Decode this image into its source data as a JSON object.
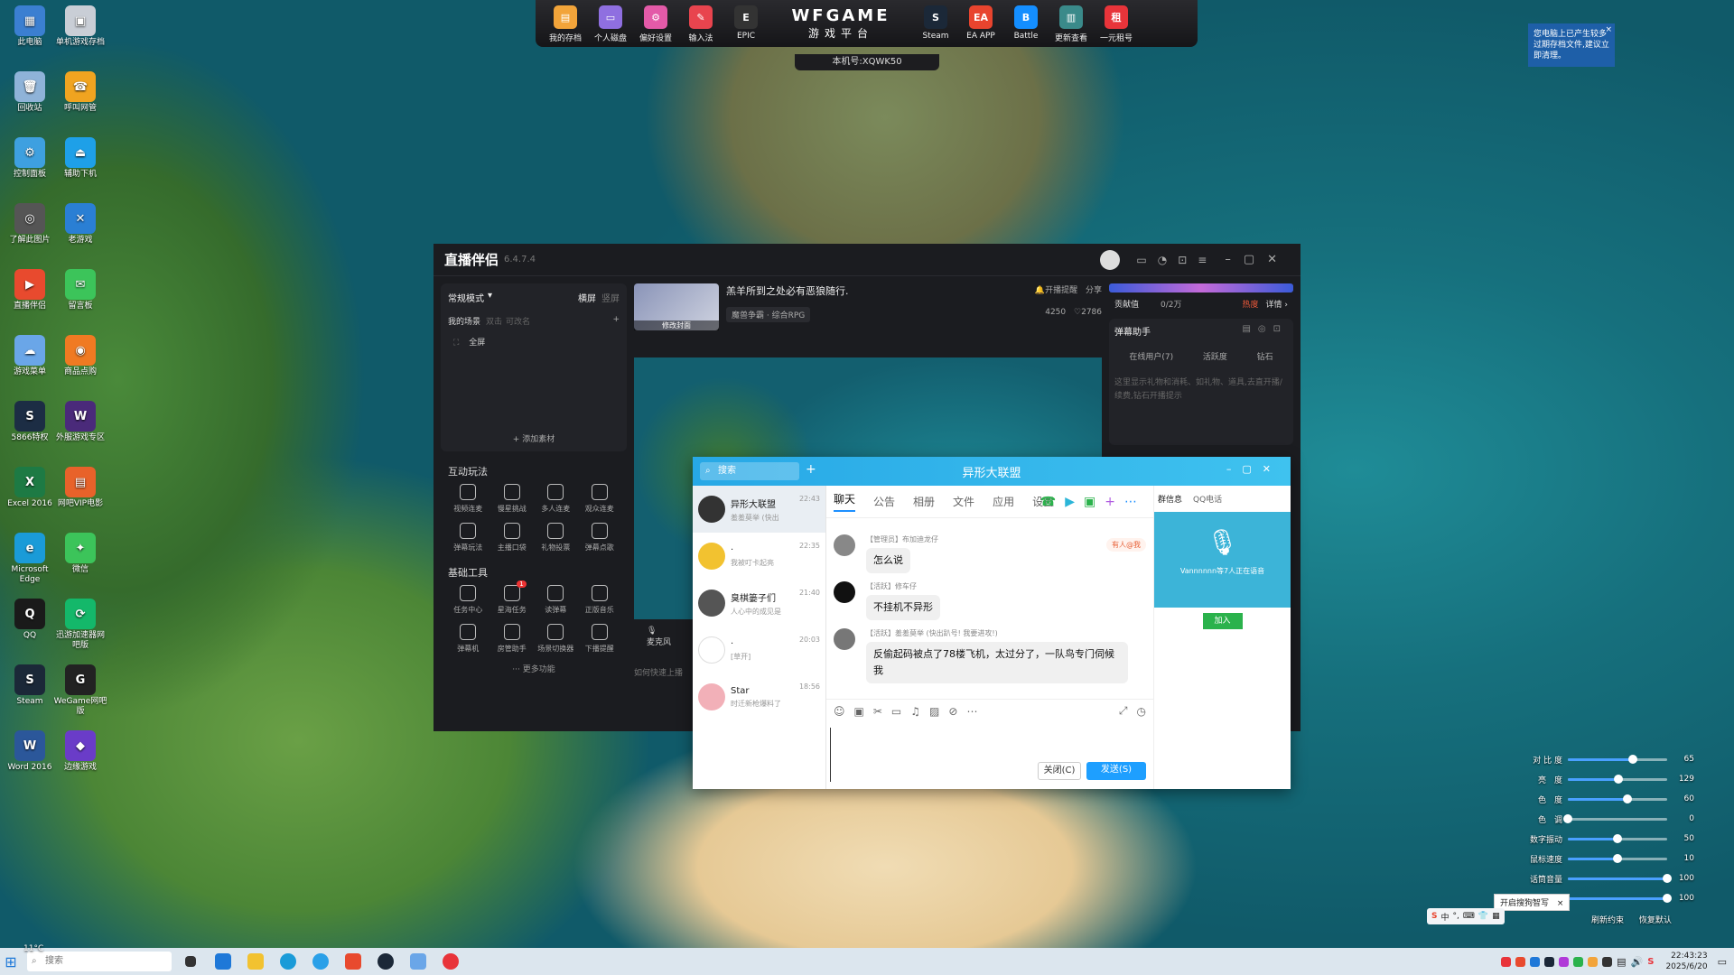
{
  "desktop": {
    "icons": [
      {
        "label": "此电脑",
        "color": "#3b7fd1",
        "glyph": "▦"
      },
      {
        "label": "单机游戏存档",
        "color": "#c9ced6",
        "glyph": "▣"
      },
      {
        "label": "回收站",
        "color": "#8fb3d8",
        "glyph": "🗑"
      },
      {
        "label": "呼叫网管",
        "color": "#f0a420",
        "glyph": "☎"
      },
      {
        "label": "控制面板",
        "color": "#3ea0e0",
        "glyph": "⚙"
      },
      {
        "label": "辅助下机",
        "color": "#1ea0e8",
        "glyph": "⏏"
      },
      {
        "label": "了解此图片",
        "color": "#555",
        "glyph": "◎"
      },
      {
        "label": "老游戏",
        "color": "#2a7fd4",
        "glyph": "✕"
      },
      {
        "label": "直播伴侣",
        "color": "#e84a2e",
        "glyph": "▶"
      },
      {
        "label": "留言板",
        "color": "#3cc45a",
        "glyph": "✉"
      },
      {
        "label": "游戏菜单",
        "color": "#6aa6e8",
        "glyph": "☁"
      },
      {
        "label": "商品点购",
        "color": "#f07a22",
        "glyph": "◉"
      },
      {
        "label": "5866特权",
        "color": "#1c2d44",
        "glyph": "S"
      },
      {
        "label": "外服游戏专区",
        "color": "#4a2a7a",
        "glyph": "W"
      },
      {
        "label": "Excel 2016",
        "color": "#1d7a44",
        "glyph": "X"
      },
      {
        "label": "网吧VIP电影",
        "color": "#e8622a",
        "glyph": "▤"
      },
      {
        "label": "Microsoft Edge",
        "color": "#1a9bd8",
        "glyph": "e"
      },
      {
        "label": "微信",
        "color": "#3cc45a",
        "glyph": "✦"
      },
      {
        "label": "QQ",
        "color": "#1a1a1a",
        "glyph": "Q"
      },
      {
        "label": "迅游加速器网吧版",
        "color": "#14b86a",
        "glyph": "⟳"
      },
      {
        "label": "Steam",
        "color": "#1b2838",
        "glyph": "S"
      },
      {
        "label": "WeGame网吧版",
        "color": "#222",
        "glyph": "G"
      },
      {
        "label": "Word 2016",
        "color": "#2b579a",
        "glyph": "W"
      },
      {
        "label": "边缘游戏",
        "color": "#6a3cc8",
        "glyph": "◆"
      }
    ]
  },
  "gamebar": {
    "left_items": [
      {
        "label": "我的存档",
        "color": "#f2a43a",
        "glyph": "▤"
      },
      {
        "label": "个人磁盘",
        "color": "#8f6fe0",
        "glyph": "▭"
      },
      {
        "label": "偏好设置",
        "color": "#e35aa8",
        "glyph": "⚙"
      },
      {
        "label": "输入法",
        "color": "#e8444e",
        "glyph": "✎"
      },
      {
        "label": "EPIC",
        "color": "#333",
        "glyph": "E"
      }
    ],
    "logo_title": "WFGAME",
    "logo_subtitle": "游戏平台",
    "right_items": [
      {
        "label": "Steam",
        "color": "#1b2838",
        "glyph": "S"
      },
      {
        "label": "EA APP",
        "color": "#e8442e",
        "glyph": "EA"
      },
      {
        "label": "Battle",
        "color": "#148eff",
        "glyph": "B"
      },
      {
        "label": "更新查看",
        "color": "#3a8a8a",
        "glyph": "▥"
      },
      {
        "label": "一元租号",
        "color": "#e8343a",
        "glyph": "租"
      }
    ],
    "machine_no": "本机号:XQWK50"
  },
  "notice": {
    "text": "您电脑上已产生较多过期存档文件,建议立即清理。"
  },
  "stream": {
    "app_name": "直播伴侣",
    "version": "6.4.7.4",
    "mode_label": "常规模式",
    "orientation": [
      "横屏",
      "竖屏"
    ],
    "scene_tabs": [
      "我的场景",
      "双击",
      "可改名"
    ],
    "scene_item": "全屏",
    "add_source": "+ 添加素材",
    "interactive_title": "互动玩法",
    "interactive": [
      "视频连麦",
      "慢星挑战",
      "多人连麦",
      "观众连麦",
      "弹幕玩法",
      "主播口袋",
      "礼物投票",
      "弹幕点歌"
    ],
    "basic_title": "基础工具",
    "basic_badge": "1",
    "basic": [
      "任务中心",
      "星海任务",
      "读弹幕",
      "正版音乐",
      "弹幕机",
      "房管助手",
      "场景切换器",
      "下播提醒"
    ],
    "more": "··· 更多功能",
    "room_title": "羔羊所到之处必有恶狼随行.",
    "cover_btn": "修改封面",
    "category": "魔兽争霸 · 综合RPG",
    "open_notify": "开播提醒",
    "share": "分享",
    "fans": "4250",
    "likes": "2786",
    "mic_label": "麦克风",
    "hint": "如何快速上播",
    "contrib_label": "贡献值",
    "contrib_val": "0/2万",
    "hot": "热度",
    "detail": "详情 ›",
    "danmu_title": "弹幕助手",
    "online": "在线用户(7)",
    "activity": "活跃度",
    "diamond": "钻石",
    "danmu_hint": "这里显示礼物和消耗、如礼物、道具,去直开播/续费,钻石开播提示"
  },
  "qq": {
    "search": "搜索",
    "title": "异形大联盟",
    "conversations": [
      {
        "name": "异形大联盟",
        "preview": "羞羞莫举 (快出",
        "time": "22:43",
        "color": "#333"
      },
      {
        "name": "·",
        "preview": "我被叮卡起亮",
        "time": "22:35",
        "color": "#f2c230"
      },
      {
        "name": "臭棋篓子们",
        "preview": "人心中的成见是",
        "time": "21:40",
        "color": "#555"
      },
      {
        "name": "·",
        "preview": "[草开]",
        "time": "20:03",
        "color": "#ffffff"
      },
      {
        "name": "Star",
        "preview": "时迁新枪爆料了",
        "time": "18:56",
        "color": "#f2b0b8"
      }
    ],
    "tabs": [
      "聊天",
      "公告",
      "相册",
      "文件",
      "应用",
      "设置"
    ],
    "mention_badge": "有人@我",
    "messages": [
      {
        "sender": "【管理员】布加迪龙仔",
        "text": "怎么说"
      },
      {
        "sender": "【活跃】修车仔",
        "text": "不挂机不异形"
      },
      {
        "sender": "【活跃】羞羞莫举 (快出趴号! 我要进攻!)",
        "text": "反偷起码被点了78楼飞机，太过分了，一队鸟专门伺候我"
      }
    ],
    "right_tabs": [
      "群信息",
      "QQ电话"
    ],
    "voice_text": "Vannnnnn等7人正在语音",
    "join": "加入",
    "close_btn": "关闭(C)",
    "send_btn": "发送(S)"
  },
  "sliders": [
    {
      "label": "对 比 度",
      "value": 65
    },
    {
      "label": "亮　度",
      "value": 129
    },
    {
      "label": "色　度",
      "value": 60
    },
    {
      "label": "色　调",
      "value": 0
    },
    {
      "label": "数字振动",
      "value": 50
    },
    {
      "label": "鼠标速度",
      "value": 10
    },
    {
      "label": "话筒音量",
      "value": 100
    },
    {
      "label": "系统音量",
      "value": 100
    }
  ],
  "slider_footer": [
    "刷新约束",
    "恢复默认"
  ],
  "ime_popup": "开启搜狗智写",
  "taskbar": {
    "search_placeholder": "搜索",
    "weather": "11°C",
    "time": "22:43:23",
    "date": "2025/6/20"
  }
}
